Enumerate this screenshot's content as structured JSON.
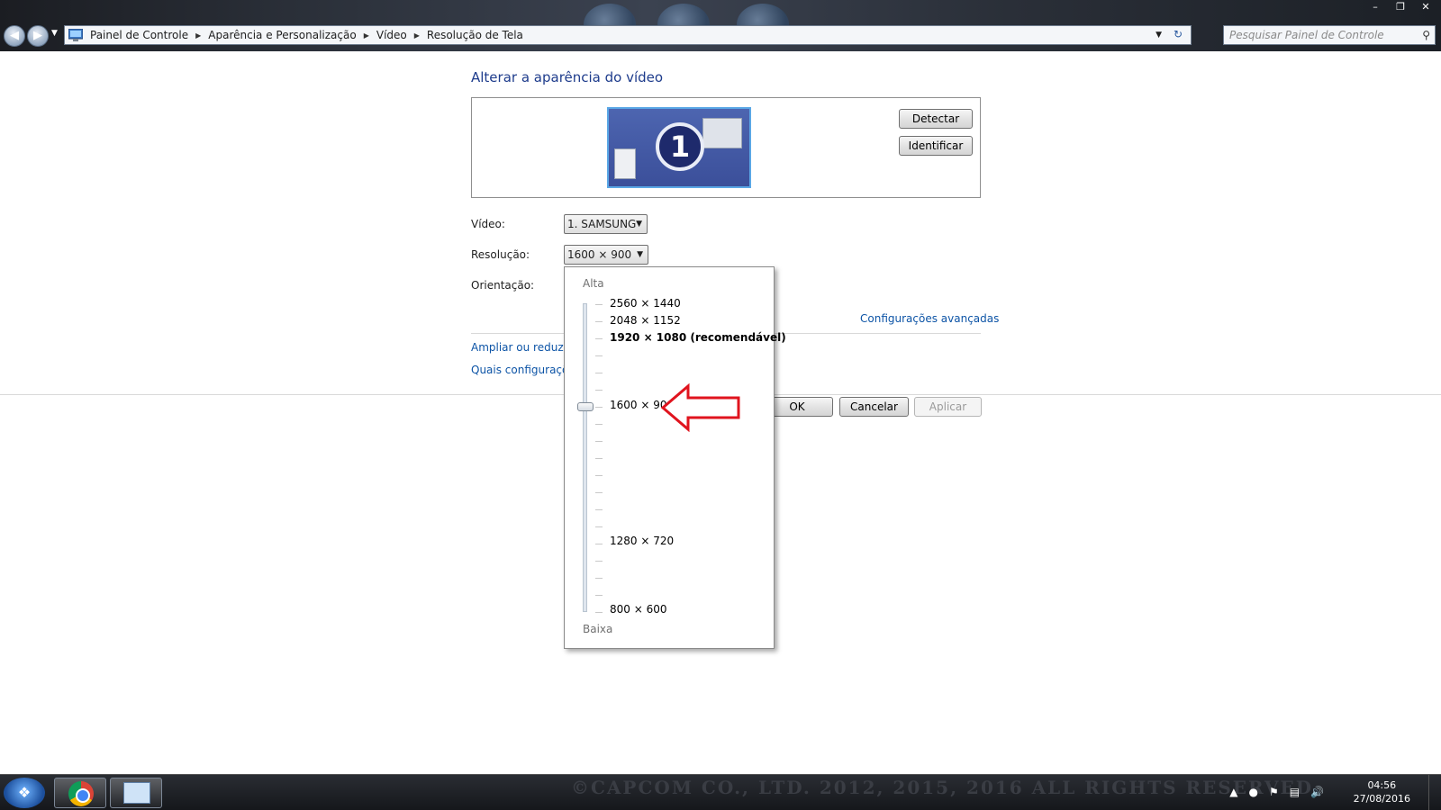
{
  "window": {
    "minimize_glyph": "–",
    "maximize_glyph": "❐",
    "close_glyph": "✕"
  },
  "address_bar": {
    "breadcrumbs": [
      "Painel de Controle",
      "Aparência e Personalização",
      "Vídeo",
      "Resolução de Tela"
    ],
    "search_placeholder": "Pesquisar Painel de Controle"
  },
  "page": {
    "title": "Alterar a aparência do vídeo",
    "monitor_number": "1",
    "detect_label": "Detectar",
    "identify_label": "Identificar",
    "display_label": "Vídeo:",
    "display_value": "1. SAMSUNG",
    "resolution_label": "Resolução:",
    "resolution_value": "1600 × 900",
    "orientation_label": "Orientação:",
    "advanced_link": "Configurações avançadas",
    "link_enlarge": "Ampliar ou reduzir t",
    "link_which": "Quais configuraçõe",
    "ok_label": "OK",
    "cancel_label": "Cancelar",
    "apply_label": "Aplicar"
  },
  "resolution_popup": {
    "high_label": "Alta",
    "low_label": "Baixa",
    "options": [
      {
        "label": "2560 × 1440"
      },
      {
        "label": "2048 × 1152"
      },
      {
        "label": "1920 × 1080 (recomendável)",
        "recommended": true
      },
      {
        "label": "1600 × 900",
        "selected": true
      },
      {
        "label": "1280 × 720"
      },
      {
        "label": "800 × 600"
      }
    ]
  },
  "taskbar": {
    "watermark": "©CAPCOM CO., LTD. 2012, 2015, 2016 ALL RIGHTS RESERVED",
    "time": "04:56",
    "date": "27/08/2016"
  },
  "colors": {
    "link": "#0d54a6",
    "title": "#1e3c8c",
    "annotation_arrow": "#e0141e"
  }
}
